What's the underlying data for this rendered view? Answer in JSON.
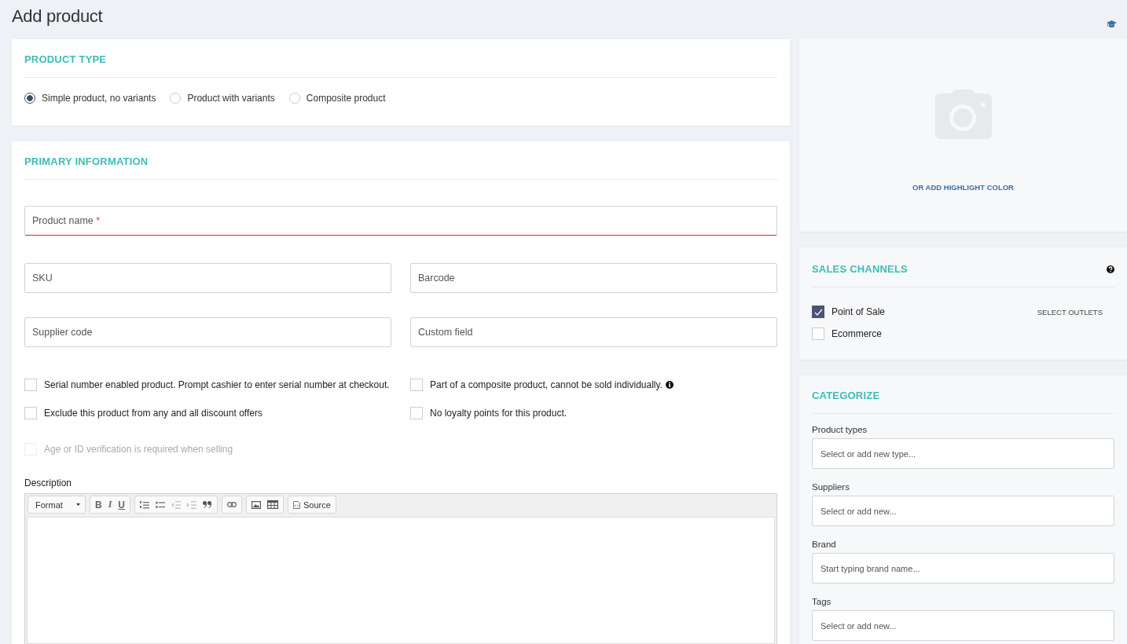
{
  "page_title": "Add product",
  "product_type": {
    "title": "PRODUCT TYPE",
    "options": [
      {
        "label": "Simple product, no variants",
        "selected": true
      },
      {
        "label": "Product with variants",
        "selected": false
      },
      {
        "label": "Composite product",
        "selected": false
      }
    ]
  },
  "primary_information": {
    "title": "PRIMARY INFORMATION",
    "name_field": {
      "placeholder": "Product name",
      "required_mark": "*",
      "error": true
    },
    "field_rows": [
      [
        {
          "placeholder": "SKU"
        },
        {
          "placeholder": "Barcode"
        }
      ],
      [
        {
          "placeholder": "Supplier code"
        },
        {
          "placeholder": "Custom field"
        }
      ]
    ],
    "option_rows": [
      [
        {
          "label": "Serial number enabled product. Prompt cashier to enter serial number at checkout.",
          "checked": false,
          "disabled": false,
          "info": false
        },
        {
          "label": "Part of a composite product, cannot be sold individually.",
          "checked": false,
          "disabled": false,
          "info": true
        }
      ],
      [
        {
          "label": "Exclude this product from any and all discount offers",
          "checked": false,
          "disabled": false,
          "info": false
        },
        {
          "label": "No loyalty points for this product.",
          "checked": false,
          "disabled": false,
          "info": false
        }
      ]
    ],
    "age_option": {
      "label": "Age or ID verification is required when selling",
      "checked": false,
      "disabled": true
    },
    "description": {
      "label": "Description",
      "format": "Format",
      "bold": "B",
      "italic": "I",
      "underline": "U",
      "indent_disabled": true,
      "source": "Source"
    }
  },
  "image": {
    "link": "OR ADD HIGHLIGHT COLOR"
  },
  "sales_channels": {
    "title": "SALES CHANNELS",
    "channels": [
      {
        "label": "Point of Sale",
        "checked": true,
        "action": "SELECT OUTLETS"
      },
      {
        "label": "Ecommerce",
        "checked": false
      }
    ]
  },
  "categorize": {
    "title": "CATEGORIZE",
    "fields": [
      {
        "label": "Product types",
        "placeholder": "Select or add new type..."
      },
      {
        "label": "Suppliers",
        "placeholder": "Select or add new..."
      },
      {
        "label": "Brand",
        "placeholder": "Start typing brand name..."
      },
      {
        "label": "Tags",
        "placeholder": "Select or add new..."
      }
    ]
  }
}
